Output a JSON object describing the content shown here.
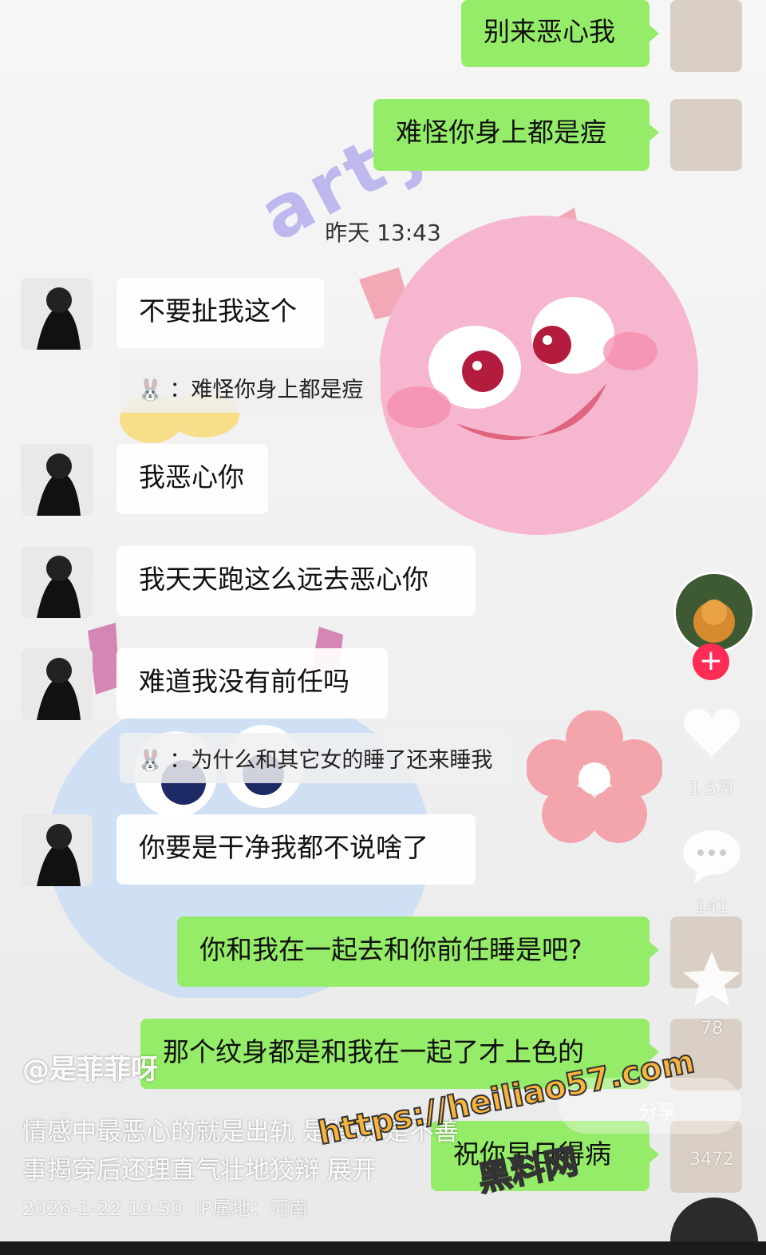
{
  "chat": {
    "timestamp": "昨天 13:43",
    "messages_self_top": [
      {
        "text": "别来恶心我"
      },
      {
        "text": "难怪你身上都是痘"
      }
    ],
    "messages_other": [
      {
        "text": "不要扯我这个"
      },
      {
        "text": "我恶心你"
      },
      {
        "text": "我天天跑这么远去恶心你"
      },
      {
        "text": "难道我没有前任吗"
      },
      {
        "text": "你要是干净我都不说啥了"
      }
    ],
    "quotes": [
      {
        "sep": "：",
        "text": "难怪你身上都是痘"
      },
      {
        "sep": "：",
        "text": "为什么和其它女的睡了还来睡我"
      }
    ],
    "messages_self_bottom": [
      {
        "text": "你和我在一起去和你前任睡是吧?"
      },
      {
        "text": "那个纹身都是和我在一起了才上色的"
      },
      {
        "text": "祝你早日得病"
      }
    ]
  },
  "decor": {
    "party_text": "arty"
  },
  "rail": {
    "likes": "1.5万",
    "comments": "141",
    "favorites": "78",
    "shares": "3472",
    "follow_icon": "plus-icon",
    "colors": {
      "follow": "#fe2c55",
      "bubble_self": "#95ec69"
    }
  },
  "caption": {
    "author": "@是菲菲呀",
    "line1": "情感中最恶心的就是出轨 是背叛 是不善",
    "line2": "事揭穿后还理直气壮地狡辩 展开",
    "date": "2026-1-22 19:50",
    "ip": "IP属地：河南",
    "share_hint": "分享"
  },
  "watermark": {
    "url": "https://heiliao57.com",
    "name": "黑料网"
  }
}
